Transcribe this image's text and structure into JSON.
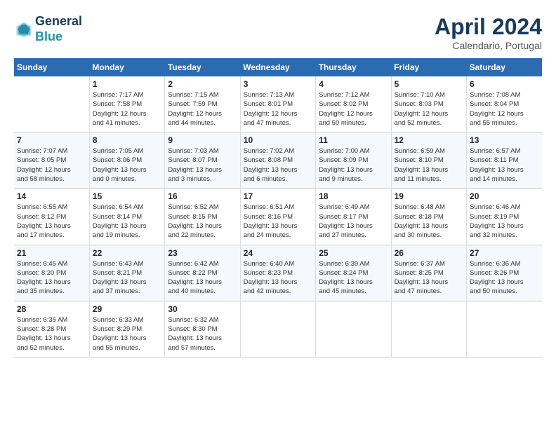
{
  "header": {
    "logo_line1": "General",
    "logo_line2": "Blue",
    "month_title": "April 2024",
    "subtitle": "Calendario, Portugal"
  },
  "columns": [
    "Sunday",
    "Monday",
    "Tuesday",
    "Wednesday",
    "Thursday",
    "Friday",
    "Saturday"
  ],
  "weeks": [
    {
      "days": [
        {
          "num": "",
          "info": ""
        },
        {
          "num": "1",
          "info": "Sunrise: 7:17 AM\nSunset: 7:58 PM\nDaylight: 12 hours\nand 41 minutes."
        },
        {
          "num": "2",
          "info": "Sunrise: 7:15 AM\nSunset: 7:59 PM\nDaylight: 12 hours\nand 44 minutes."
        },
        {
          "num": "3",
          "info": "Sunrise: 7:13 AM\nSunset: 8:01 PM\nDaylight: 12 hours\nand 47 minutes."
        },
        {
          "num": "4",
          "info": "Sunrise: 7:12 AM\nSunset: 8:02 PM\nDaylight: 12 hours\nand 50 minutes."
        },
        {
          "num": "5",
          "info": "Sunrise: 7:10 AM\nSunset: 8:03 PM\nDaylight: 12 hours\nand 52 minutes."
        },
        {
          "num": "6",
          "info": "Sunrise: 7:08 AM\nSunset: 8:04 PM\nDaylight: 12 hours\nand 55 minutes."
        }
      ]
    },
    {
      "days": [
        {
          "num": "7",
          "info": "Sunrise: 7:07 AM\nSunset: 8:05 PM\nDaylight: 12 hours\nand 58 minutes."
        },
        {
          "num": "8",
          "info": "Sunrise: 7:05 AM\nSunset: 8:06 PM\nDaylight: 13 hours\nand 0 minutes."
        },
        {
          "num": "9",
          "info": "Sunrise: 7:03 AM\nSunset: 8:07 PM\nDaylight: 13 hours\nand 3 minutes."
        },
        {
          "num": "10",
          "info": "Sunrise: 7:02 AM\nSunset: 8:08 PM\nDaylight: 13 hours\nand 6 minutes."
        },
        {
          "num": "11",
          "info": "Sunrise: 7:00 AM\nSunset: 8:09 PM\nDaylight: 13 hours\nand 9 minutes."
        },
        {
          "num": "12",
          "info": "Sunrise: 6:59 AM\nSunset: 8:10 PM\nDaylight: 13 hours\nand 11 minutes."
        },
        {
          "num": "13",
          "info": "Sunrise: 6:57 AM\nSunset: 8:11 PM\nDaylight: 13 hours\nand 14 minutes."
        }
      ]
    },
    {
      "days": [
        {
          "num": "14",
          "info": "Sunrise: 6:55 AM\nSunset: 8:12 PM\nDaylight: 13 hours\nand 17 minutes."
        },
        {
          "num": "15",
          "info": "Sunrise: 6:54 AM\nSunset: 8:14 PM\nDaylight: 13 hours\nand 19 minutes."
        },
        {
          "num": "16",
          "info": "Sunrise: 6:52 AM\nSunset: 8:15 PM\nDaylight: 13 hours\nand 22 minutes."
        },
        {
          "num": "17",
          "info": "Sunrise: 6:51 AM\nSunset: 8:16 PM\nDaylight: 13 hours\nand 24 minutes."
        },
        {
          "num": "18",
          "info": "Sunrise: 6:49 AM\nSunset: 8:17 PM\nDaylight: 13 hours\nand 27 minutes."
        },
        {
          "num": "19",
          "info": "Sunrise: 6:48 AM\nSunset: 8:18 PM\nDaylight: 13 hours\nand 30 minutes."
        },
        {
          "num": "20",
          "info": "Sunrise: 6:46 AM\nSunset: 8:19 PM\nDaylight: 13 hours\nand 32 minutes."
        }
      ]
    },
    {
      "days": [
        {
          "num": "21",
          "info": "Sunrise: 6:45 AM\nSunset: 8:20 PM\nDaylight: 13 hours\nand 35 minutes."
        },
        {
          "num": "22",
          "info": "Sunrise: 6:43 AM\nSunset: 8:21 PM\nDaylight: 13 hours\nand 37 minutes."
        },
        {
          "num": "23",
          "info": "Sunrise: 6:42 AM\nSunset: 8:22 PM\nDaylight: 13 hours\nand 40 minutes."
        },
        {
          "num": "24",
          "info": "Sunrise: 6:40 AM\nSunset: 8:23 PM\nDaylight: 13 hours\nand 42 minutes."
        },
        {
          "num": "25",
          "info": "Sunrise: 6:39 AM\nSunset: 8:24 PM\nDaylight: 13 hours\nand 45 minutes."
        },
        {
          "num": "26",
          "info": "Sunrise: 6:37 AM\nSunset: 8:25 PM\nDaylight: 13 hours\nand 47 minutes."
        },
        {
          "num": "27",
          "info": "Sunrise: 6:36 AM\nSunset: 8:26 PM\nDaylight: 13 hours\nand 50 minutes."
        }
      ]
    },
    {
      "days": [
        {
          "num": "28",
          "info": "Sunrise: 6:35 AM\nSunset: 8:28 PM\nDaylight: 13 hours\nand 52 minutes."
        },
        {
          "num": "29",
          "info": "Sunrise: 6:33 AM\nSunset: 8:29 PM\nDaylight: 13 hours\nand 55 minutes."
        },
        {
          "num": "30",
          "info": "Sunrise: 6:32 AM\nSunset: 8:30 PM\nDaylight: 13 hours\nand 57 minutes."
        },
        {
          "num": "",
          "info": ""
        },
        {
          "num": "",
          "info": ""
        },
        {
          "num": "",
          "info": ""
        },
        {
          "num": "",
          "info": ""
        }
      ]
    }
  ]
}
